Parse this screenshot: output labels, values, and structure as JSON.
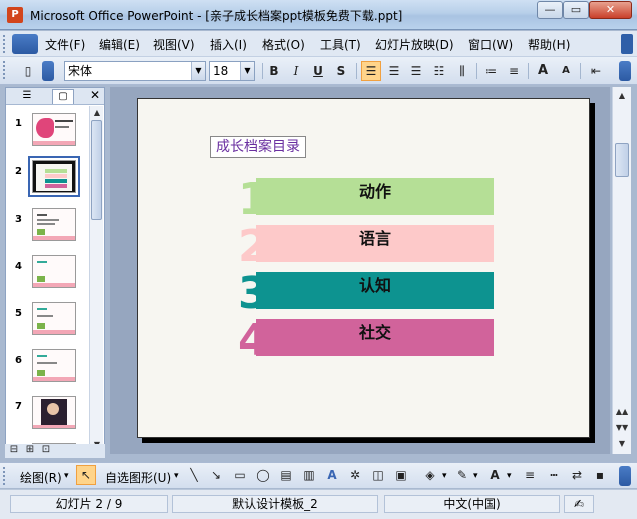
{
  "window": {
    "title": "Microsoft Office PowerPoint - [亲子成长档案ppt模板免费下载.ppt]",
    "minimize": "—",
    "restore": "▭",
    "close": "✕"
  },
  "menu": [
    "文件(F)",
    "编辑(E)",
    "视图(V)",
    "插入(I)",
    "格式(O)",
    "工具(T)",
    "幻灯片放映(D)",
    "窗口(W)",
    "帮助(H)"
  ],
  "format_toolbar": {
    "font_name": "宋体",
    "font_size": "18",
    "bold": "B",
    "italic": "I",
    "underline": "U",
    "shadow": "S",
    "grow_font": "A",
    "shrink_font": "A",
    "active_button": "align-left"
  },
  "left_panel": {
    "tabs": [
      "outline",
      "slides"
    ],
    "close_label": "✕",
    "slides": [
      "1",
      "2",
      "3",
      "4",
      "5",
      "6",
      "7"
    ],
    "selected_slide": 2
  },
  "slide": {
    "title": "成长档案目录",
    "items": [
      {
        "num": "1",
        "label": "动作",
        "bar_color": "#b5df96",
        "num_color": "#b5df96"
      },
      {
        "num": "2",
        "label": "语言",
        "bar_color": "#fdc9c9",
        "num_color": "#fdc9c9"
      },
      {
        "num": "3",
        "label": "认知",
        "bar_color": "#0d9390",
        "num_color": "#0d9390"
      },
      {
        "num": "4",
        "label": "社交",
        "bar_color": "#d1639b",
        "num_color": "#d1639b"
      }
    ]
  },
  "draw_toolbar": {
    "draw_label": "绘图(R)",
    "autoshapes_label": "自选图形(U)"
  },
  "status": {
    "slide_position": "幻灯片 2 / 9",
    "design": "默认设计模板_2",
    "language": "中文(中国)"
  }
}
